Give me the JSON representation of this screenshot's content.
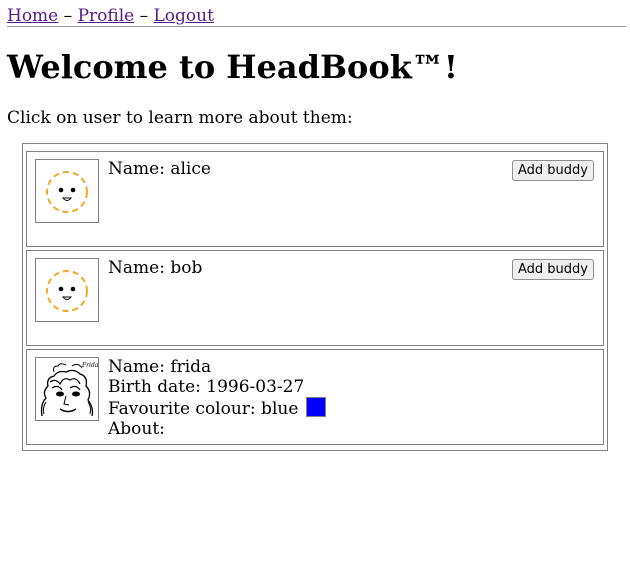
{
  "nav": {
    "home": "Home",
    "profile": "Profile",
    "logout": "Logout",
    "sep1": "–",
    "sep2": "–"
  },
  "page": {
    "title": "Welcome to HeadBook™!",
    "intro": "Click on user to learn more about them:"
  },
  "users": [
    {
      "name": "Name: alice",
      "avatar": "default-smiley-icon",
      "button": "Add buddy"
    },
    {
      "name": "Name: bob",
      "avatar": "default-smiley-icon",
      "button": "Add buddy"
    },
    {
      "name": "Name: frida",
      "avatar": "frida-sketch",
      "avatar_signature": "Frida",
      "birth_date": "Birth date: 1996-03-27",
      "colour": "Favourite colour: blue",
      "colour_value": "#0000ff",
      "about": "About:"
    }
  ],
  "colors": {
    "link": "#551a8b",
    "smiley": "#f4a92c"
  }
}
